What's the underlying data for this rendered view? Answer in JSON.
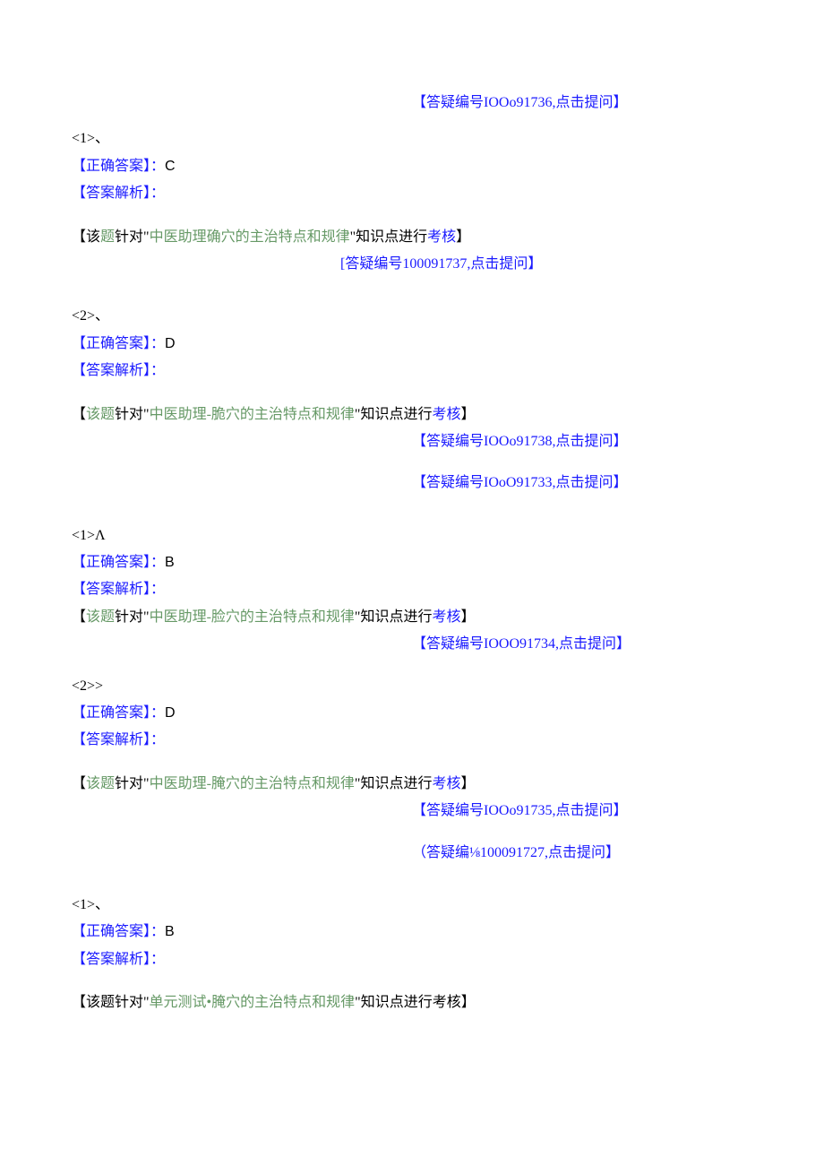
{
  "refs": {
    "r91736": "【答疑编号IOOo91736,点击提问】",
    "r100091737": "[答疑编号100091737,点击提问】",
    "r91738": "【答疑编号IOOo91738,点击提问】",
    "r91733": "【答疑编号IOoO91733,点击提问】",
    "r91734": "【答疑编号IOOO91734,点击提问】",
    "r91735": "【答疑编号IOOo91735,点击提问】",
    "r100091727": "（答疑编⅛100091727,点击提问】"
  },
  "labels": {
    "correct_answer": "【正确答案】：",
    "explain": "【答案解析】：",
    "k_prefix_black": "【该",
    "k_title_green": "题",
    "k_针对": "针对",
    "k_quote_open": "\"",
    "k_quote_close": "\"",
    "k_知识点": "知识点进行",
    "k_考核": "考核",
    "k_close": "】",
    "k_该题": "该题"
  },
  "items": [
    {
      "num": "<1>、",
      "answer": "C",
      "topic": "中医助理确穴的主治特点和规律",
      "style": "a"
    },
    {
      "num": "<2>、",
      "answer": "D",
      "topic": "中医助理-脆穴的主治特点和规律",
      "style": "b"
    },
    {
      "num": "<1>Λ",
      "answer": "B",
      "topic": "中医助理-脸穴的主治特点和规律",
      "style": "b"
    },
    {
      "num": "<2>>",
      "answer": "D",
      "topic": "中医助理-腌穴的主治特点和规律",
      "style": "b"
    },
    {
      "num": "<1>、",
      "answer": "B",
      "topic": "单元测试•腌穴的主治特点和规律",
      "style": "c"
    }
  ]
}
